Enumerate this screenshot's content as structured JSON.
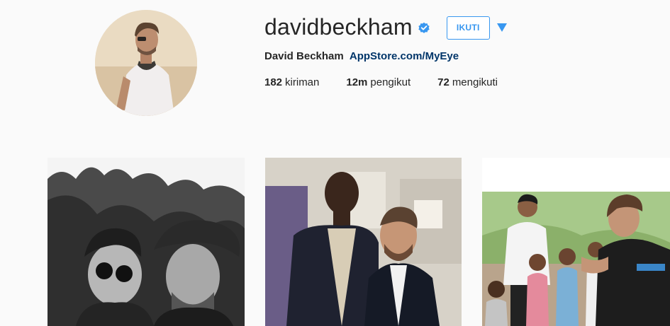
{
  "profile": {
    "username": "davidbeckham",
    "verified_icon": "verified-badge-icon",
    "follow_label": "IKUTI",
    "dropdown_icon": "triangle-down-icon",
    "full_name": "David Beckham",
    "bio_link": "AppStore.com/MyEye",
    "accent_color": "#3897f0"
  },
  "stats": [
    {
      "value": "182",
      "label": "kiriman"
    },
    {
      "value": "12m",
      "label": "pengikut"
    },
    {
      "value": "72",
      "label": "mengikuti"
    }
  ]
}
